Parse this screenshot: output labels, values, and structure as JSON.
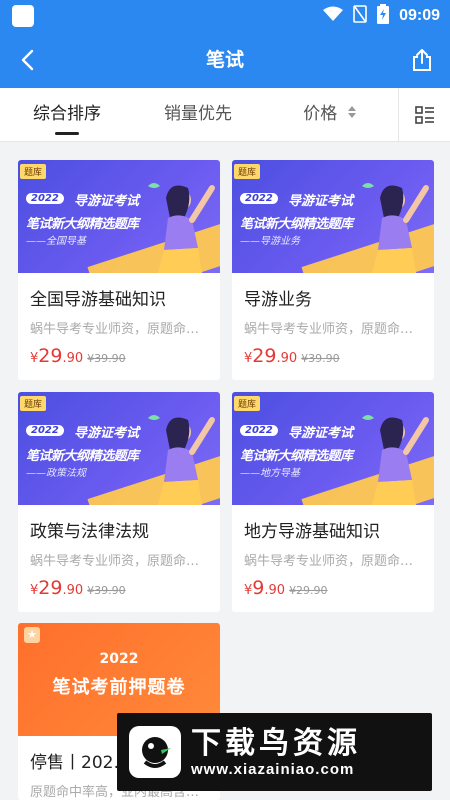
{
  "status_bar": {
    "time": "09:09"
  },
  "header": {
    "title": "笔试"
  },
  "sort_tabs": [
    {
      "label": "综合排序",
      "active": true
    },
    {
      "label": "销量优先",
      "active": false
    },
    {
      "label": "价格",
      "active": false
    }
  ],
  "colors": {
    "primary": "#2a88f0",
    "price": "#e53935",
    "banner_blue": "#4b4fe0",
    "banner_orange": "#ff6f2c"
  },
  "cards": [
    {
      "tag": "题库",
      "banner_year": "2022",
      "banner_line1": "导游证考试",
      "banner_line2": "笔试新大纲精选题库",
      "banner_line3": "——全国导基",
      "name": "全国导游基础知识",
      "desc": "蜗牛导考专业师资，原题命…",
      "price_symbol": "¥",
      "price_int": "29",
      "price_dec": ".90",
      "original_price": "¥39.90"
    },
    {
      "tag": "题库",
      "banner_year": "2022",
      "banner_line1": "导游证考试",
      "banner_line2": "笔试新大纲精选题库",
      "banner_line3": "——导游业务",
      "name": "导游业务",
      "desc": "蜗牛导考专业师资，原题命…",
      "price_symbol": "¥",
      "price_int": "29",
      "price_dec": ".90",
      "original_price": "¥39.90"
    },
    {
      "tag": "题库",
      "banner_year": "2022",
      "banner_line1": "导游证考试",
      "banner_line2": "笔试新大纲精选题库",
      "banner_line3": "——政策法规",
      "name": "政策与法律法规",
      "desc": "蜗牛导考专业师资，原题命…",
      "price_symbol": "¥",
      "price_int": "29",
      "price_dec": ".90",
      "original_price": "¥39.90"
    },
    {
      "tag": "题库",
      "banner_year": "2022",
      "banner_line1": "导游证考试",
      "banner_line2": "笔试新大纲精选题库",
      "banner_line3": "——地方导基",
      "name": "地方导游基础知识",
      "desc": "蜗牛导考专业师资，原题命…",
      "price_symbol": "¥",
      "price_int": "9",
      "price_dec": ".90",
      "original_price": "¥29.90"
    },
    {
      "banner_year": "2022",
      "banner_title": "笔试考前押题卷",
      "name": "停售丨202…",
      "desc": "原题命中率高，业内最高含…"
    }
  ],
  "watermark": {
    "title": "下载鸟资源",
    "url": "www.xiazainiao.com"
  }
}
